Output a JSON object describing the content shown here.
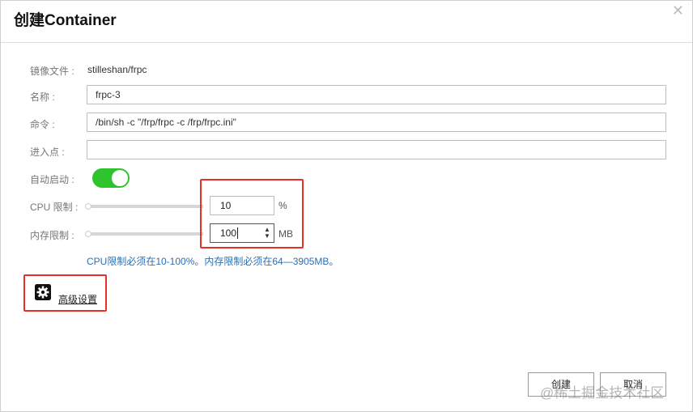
{
  "dialog": {
    "title": "创建Container",
    "close_icon": "close-icon"
  },
  "form": {
    "image": {
      "label": "镜像文件 :",
      "value": "stilleshan/frpc"
    },
    "name": {
      "label": "名称 :",
      "value": "frpc-3"
    },
    "command": {
      "label": "命令 :",
      "value": "/bin/sh -c \"/frp/frpc -c /frp/frpc.ini\""
    },
    "entrypoint": {
      "label": "进入点 :",
      "value": ""
    },
    "autostart": {
      "label": "自动启动 :",
      "on": true
    },
    "cpu_limit": {
      "label": "CPU 限制 :",
      "value": "10",
      "unit": "%"
    },
    "mem_limit": {
      "label": "内存限制 :",
      "value": "100",
      "unit": "MB"
    },
    "hint": "CPU限制必须在10-100%。内存限制必须在64—3905MB。"
  },
  "advanced": {
    "label": "高级设置",
    "icon": "gear-icon"
  },
  "footer": {
    "create_label": "创建",
    "cancel_label": "取消"
  },
  "watermark": "@稀土掘金技术社区",
  "colors": {
    "toggle_on": "#2dc42d",
    "highlight_box": "#e8302b",
    "hint_text": "#2a6fb5"
  }
}
